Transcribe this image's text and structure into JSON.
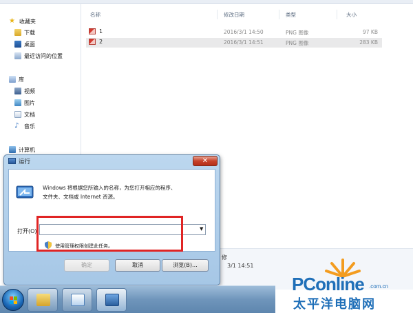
{
  "explorer": {
    "nav": {
      "favorites_label": "收藏夹",
      "favorites_items": [
        "下载",
        "桌面",
        "最近访问的位置"
      ],
      "libraries_label": "库",
      "library_items": [
        "视频",
        "图片",
        "文档",
        "音乐"
      ],
      "computer_label": "计算机"
    },
    "columns": {
      "name": "名称",
      "modified": "修改日期",
      "type": "类型",
      "size": "大小"
    },
    "files": [
      {
        "name": "1",
        "modified": "2016/3/1 14:50",
        "type": "PNG 图像",
        "size": "97 KB",
        "selected": false
      },
      {
        "name": "2",
        "modified": "2016/3/1 14:51",
        "type": "PNG 图像",
        "size": "283 KB",
        "selected": true
      }
    ],
    "details": {
      "label": "修",
      "time": "3/1 14:51"
    }
  },
  "run_dialog": {
    "title": "运行",
    "close_glyph": "✕",
    "description_line1": "Windows 将根据您所输入的名称，为您打开相应的程序、",
    "description_line2": "文件夹、文档或 Internet 资源。",
    "open_label": "打开(O):",
    "open_value": "",
    "dropdown_glyph": "▼",
    "admin_note": "使用管理权限创建此任务。",
    "buttons": {
      "ok": "确定",
      "cancel": "取消",
      "browse": "浏览(B)..."
    },
    "highlight_color": "#e02424"
  },
  "taskbar": {
    "items": [
      "start-orb",
      "file-explorer",
      "chat-window",
      "run-window"
    ]
  },
  "watermark": {
    "brand": "PConline",
    "domain": ".com.cn",
    "chinese": "太平洋电脑网",
    "color": "#1f6fb8",
    "sun_color": "#f39c1f"
  }
}
